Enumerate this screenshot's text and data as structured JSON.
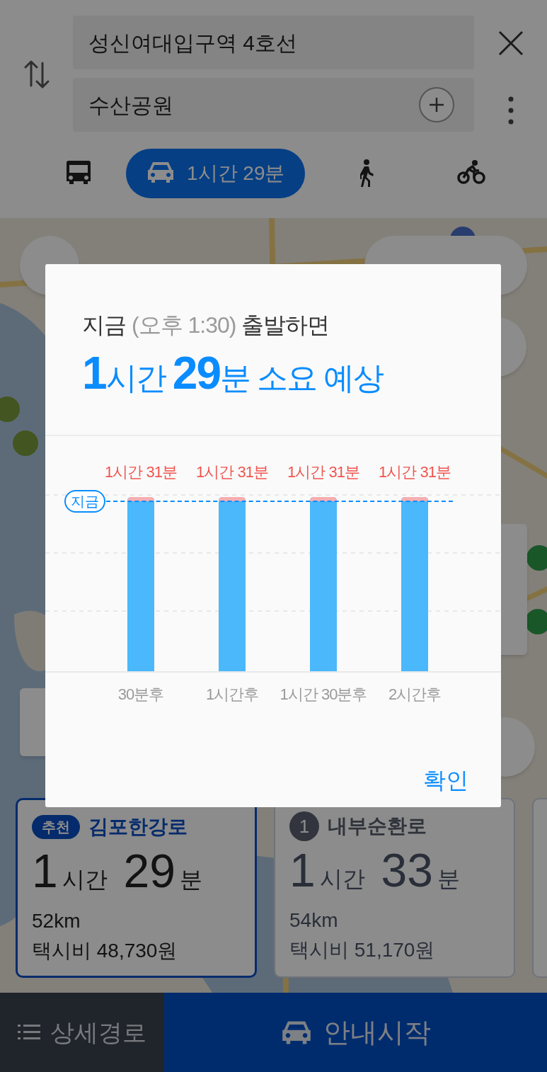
{
  "route": {
    "origin": "성신여대입구역 4호선",
    "destination": "수산공원"
  },
  "modes": [
    {
      "kind": "bus",
      "selected": false
    },
    {
      "kind": "car",
      "selected": true,
      "label": "1시간 29분"
    },
    {
      "kind": "walk",
      "selected": false
    },
    {
      "kind": "bike",
      "selected": false
    }
  ],
  "routes": [
    {
      "kind": "recommended",
      "badge": "추천",
      "name": "김포한강로",
      "duration": "**1**시간 **29**분",
      "distance": "52km",
      "fare": "택시비 48,730원",
      "selected": true
    },
    {
      "kind": "numbered",
      "badge": "1",
      "name": "내부순환로",
      "duration": "**1**시간 **33**분",
      "distance": "54km",
      "fare": "택시비 51,170원",
      "selected": false
    }
  ],
  "bottom_bar": {
    "details_button": "상세경로",
    "start_button": "안내시작"
  },
  "dialog": {
    "heading": [
      {
        "text": "지금",
        "muted": false
      },
      {
        "text": "(오후 1:30)",
        "muted": true
      },
      {
        "text": "출발하면",
        "muted": false
      }
    ],
    "estimate": "**1**시간 **29**분 소요 예상",
    "now_marker": {
      "label": "지금"
    },
    "departures": [
      {
        "time": "30분후",
        "duration": "1시간 31분",
        "level": 1
      },
      {
        "time": "1시간후",
        "duration": "1시간 31분",
        "level": 1
      },
      {
        "time": "1시간 30분후",
        "duration": "1시간 31분",
        "level": 1
      },
      {
        "time": "2시간후",
        "duration": "1시간 31분",
        "level": 1
      }
    ],
    "confirm_button": "확인"
  }
}
